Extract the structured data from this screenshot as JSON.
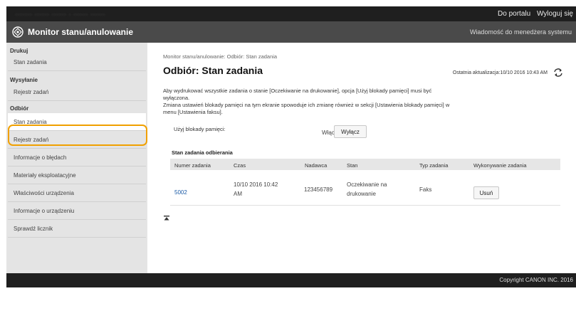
{
  "topbar": {
    "blurred_text": "·······   ······ ······ · ······ ······",
    "portal_link": "Do portalu",
    "logout_link": "Wyloguj się"
  },
  "header": {
    "app_title": "Monitor stanu/anulowanie",
    "message_link": "Wiadomość do menedżera systemu"
  },
  "sidebar": {
    "print_section": "Drukuj",
    "print_items": [
      "Stan zadania"
    ],
    "send_section": "Wysyłanie",
    "send_items": [
      "Rejestr zadań"
    ],
    "receive_section": "Odbiór",
    "receive_items": [
      "Stan zadania",
      "Rejestr zadań",
      "Informacje o błędach",
      "Materiały eksploatacyjne",
      "Właściwości urządzenia",
      "Informacje o urządzeniu",
      "Sprawdź licznik"
    ]
  },
  "main": {
    "breadcrumb": "Monitor stanu/anulowanie: Odbiór: Stan zadania",
    "title": "Odbiór: Stan zadania",
    "last_updated": "Ostatnia aktualizacja:10/10 2016 10:43 AM",
    "note_lines": [
      "Aby wydrukować wszystkie zadania o stanie [Oczekiwanie na drukowanie], opcja [Użyj blokady pamięci] musi być",
      "wyłączona.",
      "Zmiana ustawień blokady pamięci na tym ekranie spowoduje ich zmianę również w sekcji [Ustawienia blokady pamięci] w",
      "menu [Ustawienia faksu]."
    ],
    "memory_lock_label": "Użyj blokady pamięci:",
    "memory_lock_on": "Włącz",
    "memory_lock_off_button": "Wyłącz",
    "table_title": "Stan zadania odbierania",
    "table_headers": [
      "Numer zadania",
      "Czas",
      "Nadawca",
      "Stan",
      "Typ zadania",
      "Wykonywanie zadania"
    ],
    "table_rows": [
      {
        "job_number": "5002",
        "time_line1": "10/10 2016 10:42",
        "time_line2": "AM",
        "sender": "123456789",
        "status_line1": "Oczekiwanie na",
        "status_line2": "drukowanie",
        "type": "Faks",
        "action": "Usuń"
      }
    ]
  },
  "footer": {
    "copyright": "Copyright CANON INC. 2016"
  }
}
